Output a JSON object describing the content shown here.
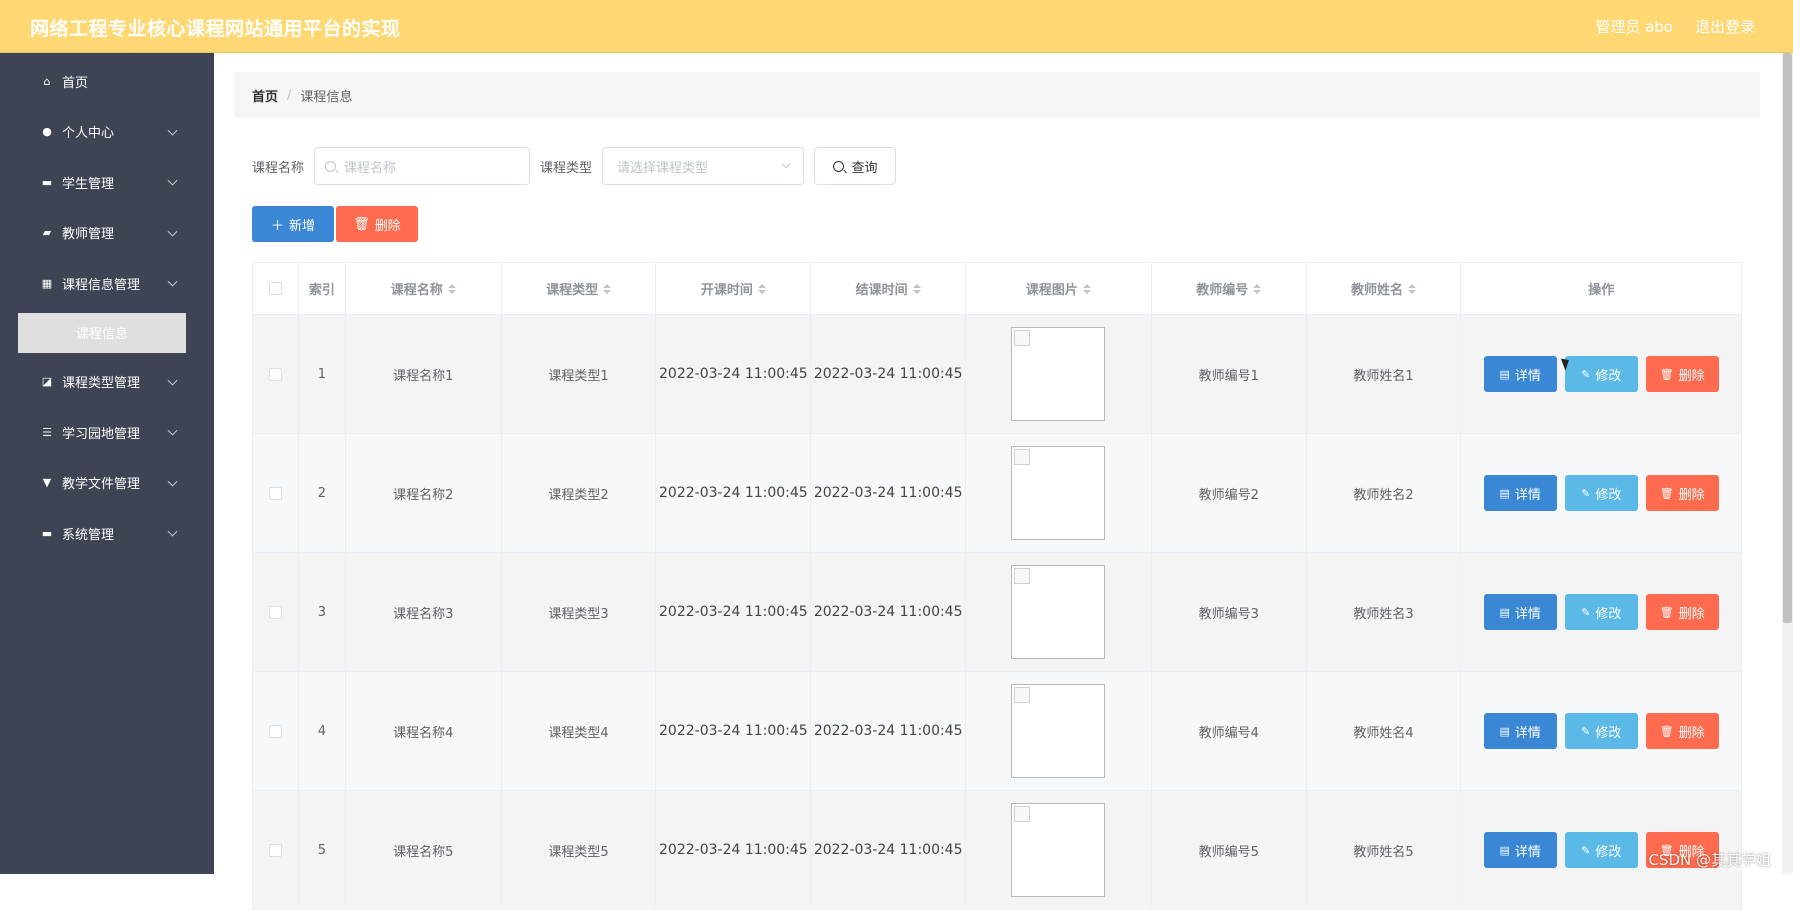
{
  "header": {
    "title": "网络工程专业核心课程网站通用平台的实现",
    "user_label": "管理员 abo",
    "logout": "退出登录"
  },
  "sidebar": {
    "items": [
      {
        "label": "首页",
        "icon": "home-icon",
        "glyph": "⌂",
        "expandable": false
      },
      {
        "label": "个人中心",
        "icon": "user-icon",
        "glyph": "●",
        "expandable": true
      },
      {
        "label": "学生管理",
        "icon": "briefcase-icon",
        "glyph": "▬",
        "expandable": true
      },
      {
        "label": "教师管理",
        "icon": "teacher-icon",
        "glyph": "▰",
        "expandable": true
      },
      {
        "label": "课程信息管理",
        "icon": "grid-icon",
        "glyph": "▦",
        "expandable": true
      },
      {
        "label": "课程类型管理",
        "icon": "chart-icon",
        "glyph": "◪",
        "expandable": true
      },
      {
        "label": "学习园地管理",
        "icon": "sliders-icon",
        "glyph": "☰",
        "expandable": true
      },
      {
        "label": "教学文件管理",
        "icon": "file-icon",
        "glyph": "▼",
        "expandable": true
      },
      {
        "label": "系统管理",
        "icon": "system-icon",
        "glyph": "▬",
        "expandable": true
      }
    ],
    "submenu": {
      "label": "课程信息",
      "parent_index": 4
    }
  },
  "breadcrumb": {
    "home": "首页",
    "separator": "/",
    "current": "课程信息"
  },
  "filter": {
    "name_label": "课程名称",
    "name_placeholder": "课程名称",
    "type_label": "课程类型",
    "type_placeholder": "请选择课程类型",
    "query": "查询"
  },
  "actions": {
    "add": "新增",
    "delete": "删除"
  },
  "table": {
    "columns": [
      "索引",
      "课程名称",
      "课程类型",
      "开课时间",
      "结课时间",
      "课程图片",
      "教师编号",
      "教师姓名",
      "操作"
    ],
    "rows": [
      {
        "index": "1",
        "name": "课程名称1",
        "type": "课程类型1",
        "start": "2022-03-24 11:00:45",
        "end": "2022-03-24 11:00:45",
        "teacher_no": "教师编号1",
        "teacher_name": "教师姓名1"
      },
      {
        "index": "2",
        "name": "课程名称2",
        "type": "课程类型2",
        "start": "2022-03-24 11:00:45",
        "end": "2022-03-24 11:00:45",
        "teacher_no": "教师编号2",
        "teacher_name": "教师姓名2"
      },
      {
        "index": "3",
        "name": "课程名称3",
        "type": "课程类型3",
        "start": "2022-03-24 11:00:45",
        "end": "2022-03-24 11:00:45",
        "teacher_no": "教师编号3",
        "teacher_name": "教师姓名3"
      },
      {
        "index": "4",
        "name": "课程名称4",
        "type": "课程类型4",
        "start": "2022-03-24 11:00:45",
        "end": "2022-03-24 11:00:45",
        "teacher_no": "教师编号4",
        "teacher_name": "教师姓名4"
      },
      {
        "index": "5",
        "name": "课程名称5",
        "type": "课程类型5",
        "start": "2022-03-24 11:00:45",
        "end": "2022-03-24 11:00:45",
        "teacher_no": "教师编号5",
        "teacher_name": "教师姓名5"
      }
    ],
    "row_actions": {
      "detail": "详情",
      "edit": "修改",
      "delete": "删除"
    }
  },
  "watermark": "CSDN @其其学姐",
  "colors": {
    "header": "#ffd874",
    "sidebar": "#3e4454",
    "primary": "#3a87d6",
    "info": "#5ab9e6",
    "danger": "#fe6b4e"
  }
}
